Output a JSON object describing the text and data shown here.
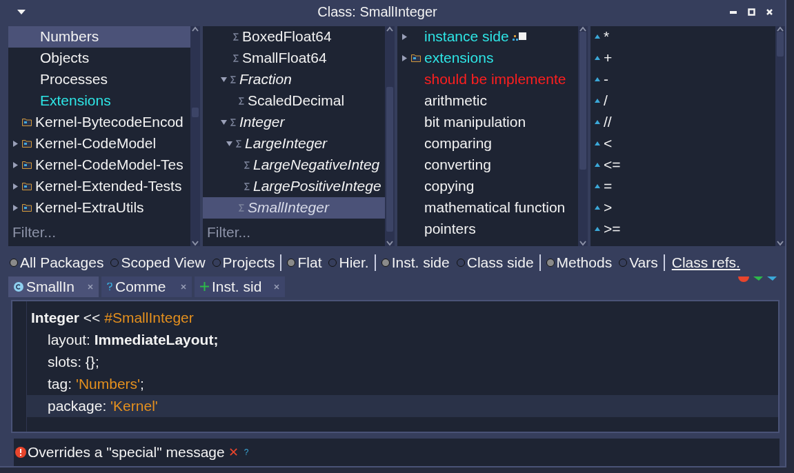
{
  "window": {
    "title": "Class: SmallInteger"
  },
  "packages": {
    "items": [
      {
        "label": "Numbers",
        "kind": "tag",
        "selected": true,
        "color": "#f2f2f2"
      },
      {
        "label": "Objects",
        "kind": "tag",
        "selected": false,
        "color": "#f2f2f2"
      },
      {
        "label": "Processes",
        "kind": "tag",
        "selected": false,
        "color": "#f2f2f2"
      },
      {
        "label": "Extensions",
        "kind": "tag",
        "selected": false,
        "color": "#2ee6e6"
      },
      {
        "label": "Kernel-BytecodeEncod",
        "kind": "package",
        "expandable": false,
        "selected": false,
        "color": "#f2f2f2"
      },
      {
        "label": "Kernel-CodeModel",
        "kind": "package",
        "expandable": true,
        "selected": false,
        "color": "#f2f2f2"
      },
      {
        "label": "Kernel-CodeModel-Tes",
        "kind": "package",
        "expandable": true,
        "selected": false,
        "color": "#f2f2f2"
      },
      {
        "label": "Kernel-Extended-Tests",
        "kind": "package",
        "expandable": true,
        "selected": false,
        "color": "#f2f2f2"
      },
      {
        "label": "Kernel-ExtraUtils",
        "kind": "package",
        "expandable": true,
        "selected": false,
        "color": "#f2f2f2"
      }
    ],
    "filter": {
      "placeholder": "Filter..."
    }
  },
  "classes": {
    "items": [
      {
        "label": "BoxedFloat64",
        "abstract": false,
        "selected": false
      },
      {
        "label": "SmallFloat64",
        "abstract": false,
        "selected": false
      },
      {
        "label": "Fraction",
        "abstract": true,
        "expanded": true,
        "selected": false,
        "children": [
          {
            "label": "ScaledDecimal",
            "abstract": false,
            "selected": false
          }
        ]
      },
      {
        "label": "Integer",
        "abstract": true,
        "expanded": true,
        "selected": false,
        "children": [
          {
            "label": "LargeInteger",
            "abstract": true,
            "expanded": true,
            "selected": false,
            "children": [
              {
                "label": "LargeNegativeInteg",
                "abstract": true,
                "selected": false
              },
              {
                "label": "LargePositiveIntege",
                "abstract": true,
                "selected": false
              }
            ]
          },
          {
            "label": "SmallInteger",
            "abstract": true,
            "selected": true
          }
        ]
      }
    ],
    "filter": {
      "placeholder": "Filter..."
    }
  },
  "protocols": {
    "items": [
      {
        "label": "instance side",
        "kind": "side",
        "expandable": true,
        "color": "#2ee6e6"
      },
      {
        "label": "extensions",
        "kind": "folder",
        "expandable": true,
        "color": "#2ee6e6"
      },
      {
        "label": "should be implemente",
        "kind": "plain",
        "expandable": false,
        "color": "#ff1f1f"
      },
      {
        "label": "arithmetic",
        "kind": "plain",
        "expandable": false,
        "color": "#f2f2f2"
      },
      {
        "label": "bit manipulation",
        "kind": "plain",
        "expandable": false,
        "color": "#f2f2f2"
      },
      {
        "label": "comparing",
        "kind": "plain",
        "expandable": false,
        "color": "#f2f2f2"
      },
      {
        "label": "converting",
        "kind": "plain",
        "expandable": false,
        "color": "#f2f2f2"
      },
      {
        "label": "copying",
        "kind": "plain",
        "expandable": false,
        "color": "#f2f2f2"
      },
      {
        "label": "mathematical function",
        "kind": "plain",
        "expandable": false,
        "color": "#f2f2f2"
      },
      {
        "label": "pointers",
        "kind": "plain",
        "expandable": false,
        "color": "#f2f2f2"
      }
    ]
  },
  "methods": {
    "items": [
      {
        "label": "*",
        "overrides": true
      },
      {
        "label": "+",
        "overrides": true
      },
      {
        "label": "-",
        "overrides": true
      },
      {
        "label": "/",
        "overrides": true
      },
      {
        "label": "//",
        "overrides": true
      },
      {
        "label": "<",
        "overrides": true
      },
      {
        "label": "<=",
        "overrides": true
      },
      {
        "label": "=",
        "overrides": true
      },
      {
        "label": ">",
        "overrides": true
      },
      {
        "label": ">=",
        "overrides": true
      }
    ]
  },
  "options": [
    {
      "kind": "radio",
      "label": "All Packages",
      "selected": true
    },
    {
      "kind": "radio",
      "label": "Scoped View",
      "selected": false
    },
    {
      "kind": "radio",
      "label": "Projects",
      "selected": false
    },
    {
      "kind": "separator"
    },
    {
      "kind": "radio",
      "label": "Flat",
      "selected": true
    },
    {
      "kind": "radio",
      "label": "Hier.",
      "selected": false
    },
    {
      "kind": "separator"
    },
    {
      "kind": "radio",
      "label": "Inst. side",
      "selected": true
    },
    {
      "kind": "radio",
      "label": "Class side",
      "selected": false
    },
    {
      "kind": "separator"
    },
    {
      "kind": "radio",
      "label": "Methods",
      "selected": true
    },
    {
      "kind": "radio",
      "label": "Vars",
      "selected": false
    },
    {
      "kind": "separator"
    },
    {
      "kind": "link",
      "label": "Class refs."
    }
  ],
  "tabs": [
    {
      "label": "SmallIn",
      "kind": "class",
      "selected": true
    },
    {
      "label": "Comme",
      "kind": "comment",
      "selected": false
    },
    {
      "label": "Inst. sid",
      "kind": "add",
      "selected": false
    }
  ],
  "editor": {
    "lines": [
      {
        "highlighted": false,
        "tokens": [
          {
            "kind": "bold",
            "text": "Integer"
          },
          {
            "kind": "plain",
            "text": " << "
          },
          {
            "kind": "literal",
            "text": "#SmallInteger"
          }
        ],
        "children": [
          {
            "highlighted": false,
            "tokens": [
              {
                "kind": "plain",
                "text": "layout: "
              },
              {
                "kind": "bold",
                "text": "ImmediateLayout;"
              }
            ]
          },
          {
            "highlighted": false,
            "tokens": [
              {
                "kind": "plain",
                "text": "slots: {};"
              }
            ]
          },
          {
            "highlighted": false,
            "tokens": [
              {
                "kind": "plain",
                "text": "tag: "
              },
              {
                "kind": "literal",
                "text": "'Numbers'"
              },
              {
                "kind": "plain",
                "text": ";"
              }
            ]
          },
          {
            "highlighted": true,
            "tokens": [
              {
                "kind": "plain",
                "text": "package: "
              },
              {
                "kind": "literal",
                "text": "'Kernel'"
              }
            ]
          }
        ]
      }
    ]
  },
  "critique": {
    "message": "Overrides a \"special\" message",
    "close": "✕",
    "help": "?"
  }
}
